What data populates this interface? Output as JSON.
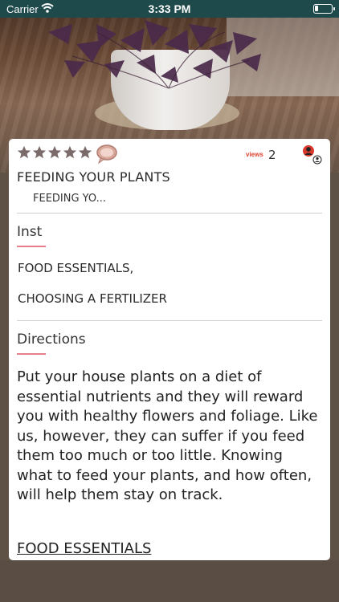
{
  "status_bar": {
    "carrier": "Carrier",
    "time": "3:33 PM"
  },
  "hero": {
    "image": "purple-shamrock-plant-in-pot"
  },
  "card": {
    "rating": {
      "stars": 5,
      "filled": 5,
      "star_color": "#7a6a6a"
    },
    "comment_icon": "speech-bubble-icon",
    "views_label": "views",
    "views_count": "2",
    "profile_icon": "user-profile-icon",
    "title": "FEEDING YOUR PLANTS",
    "subtitle": "FEEDING YO...",
    "inst": {
      "heading": "Inst",
      "items": [
        "FOOD ESSENTIALS,",
        "CHOOSING A FERTILIZER"
      ]
    },
    "directions": {
      "heading": "Directions",
      "text": "Put your house plants on a diet of essential nutrients and they will reward you with healthy flowers and foliage. Like us, however, they can suffer if you feed them too much or too little. Knowing what to feed your plants, and how often, will help them stay on track.",
      "food_heading": "FOOD ESSENTIALS"
    }
  },
  "colors": {
    "accent": "#e0422f",
    "underline": "#e5808a",
    "status_bar": "#1f4a4c",
    "background": "#5e5145"
  }
}
